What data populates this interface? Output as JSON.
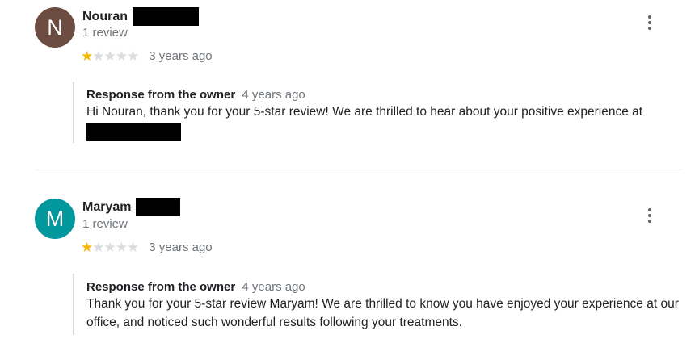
{
  "reviews": [
    {
      "avatar_letter": "N",
      "avatar_color": "#6d4c41",
      "name": "Nouran",
      "review_count": "1 review",
      "rating": 1,
      "date": "3 years ago",
      "owner_label": "Response from the owner",
      "owner_date": "4 years ago",
      "owner_text": "Hi Nouran, thank you for your 5-star review! We are thrilled to hear about your positive experience at"
    },
    {
      "avatar_letter": "M",
      "avatar_color": "#00979d",
      "name": "Maryam",
      "review_count": "1 review",
      "rating": 1,
      "date": "3 years ago",
      "owner_label": "Response from the owner",
      "owner_date": "4 years ago",
      "owner_text": "Thank you for your 5-star review Maryam! We are thrilled to know you have enjoyed your experience at our office, and noticed such wonderful results following your treatments."
    }
  ],
  "colors": {
    "star_filled": "#f7b502",
    "star_empty": "#dadce0",
    "secondary_text": "#70757a"
  },
  "icons": {
    "star": "star-icon",
    "menu": "more-vert-icon"
  }
}
